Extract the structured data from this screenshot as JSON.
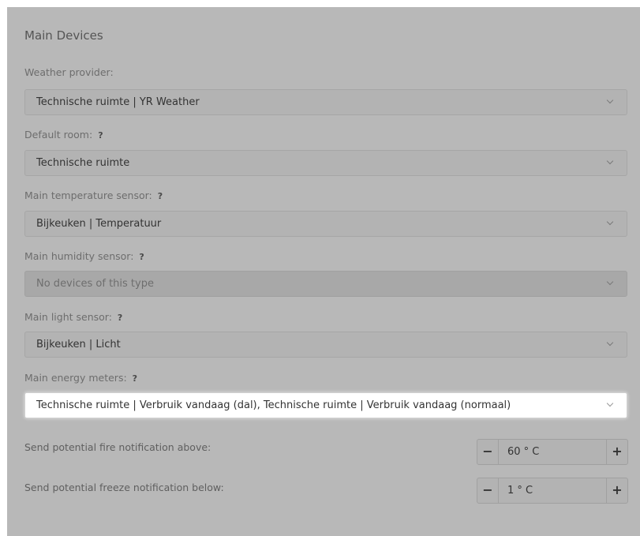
{
  "section": {
    "title": "Main Devices"
  },
  "fields": [
    {
      "label": "Weather provider:",
      "help": "",
      "value": "Technische ruimte | YR Weather"
    },
    {
      "label": "Default room:",
      "help": "?",
      "value": "Technische ruimte"
    },
    {
      "label": "Main temperature sensor:",
      "help": "?",
      "value": "Bijkeuken | Temperatuur"
    },
    {
      "label": "Main humidity sensor:",
      "help": "?",
      "value": "No devices of this type"
    },
    {
      "label": "Main light sensor:",
      "help": "?",
      "value": "Bijkeuken | Licht"
    },
    {
      "label": "Main energy meters:",
      "help": "?",
      "value": "Technische ruimte | Verbruik vandaag (dal), Technische ruimte | Verbruik vandaag (normaal)"
    }
  ],
  "notifications": {
    "fire": {
      "label": "Send potential fire notification above:",
      "value": "60 ° C",
      "minus": "−",
      "plus": "+"
    },
    "freeze": {
      "label": "Send potential freeze notification below:",
      "value": "1 ° C",
      "minus": "−",
      "plus": "+"
    }
  },
  "icons": {
    "dropdown": "chevron-down-icon"
  }
}
